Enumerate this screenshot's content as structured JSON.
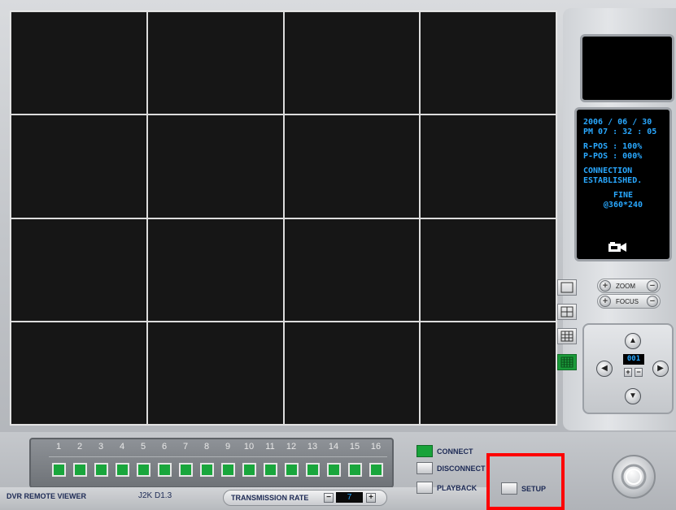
{
  "info": {
    "date": "2006 / 06 / 30",
    "time": "PM 07 : 32 : 05",
    "r_pos": "R-POS : 100%",
    "p_pos": "P-POS : 000%",
    "connection_line1": "CONNECTION",
    "connection_line2": "ESTABLISHED.",
    "quality": "FINE",
    "resolution": "@360*240"
  },
  "zoom": {
    "label": "ZOOM",
    "plus": "+",
    "minus": "−"
  },
  "focus": {
    "label": "FOCUS",
    "plus": "+",
    "minus": "−"
  },
  "ptz": {
    "camera_number": "001",
    "plus": "+",
    "minus": "−"
  },
  "channels": [
    "1",
    "2",
    "3",
    "4",
    "5",
    "6",
    "7",
    "8",
    "9",
    "10",
    "11",
    "12",
    "13",
    "14",
    "15",
    "16"
  ],
  "actions": {
    "connect": "CONNECT",
    "disconnect": "DISCONNECT",
    "playback": "PLAYBACK",
    "setup": "SETUP"
  },
  "footer": {
    "app_title": "DVR REMOTE VIEWER",
    "version": "J2K D1.3",
    "transmission_label": "TRANSMISSION RATE",
    "transmission_value": "7",
    "minus": "−",
    "plus": "+"
  },
  "colors": {
    "accent_green": "#19a63c",
    "info_text": "#29a8ff",
    "highlight": "#ff0000"
  }
}
